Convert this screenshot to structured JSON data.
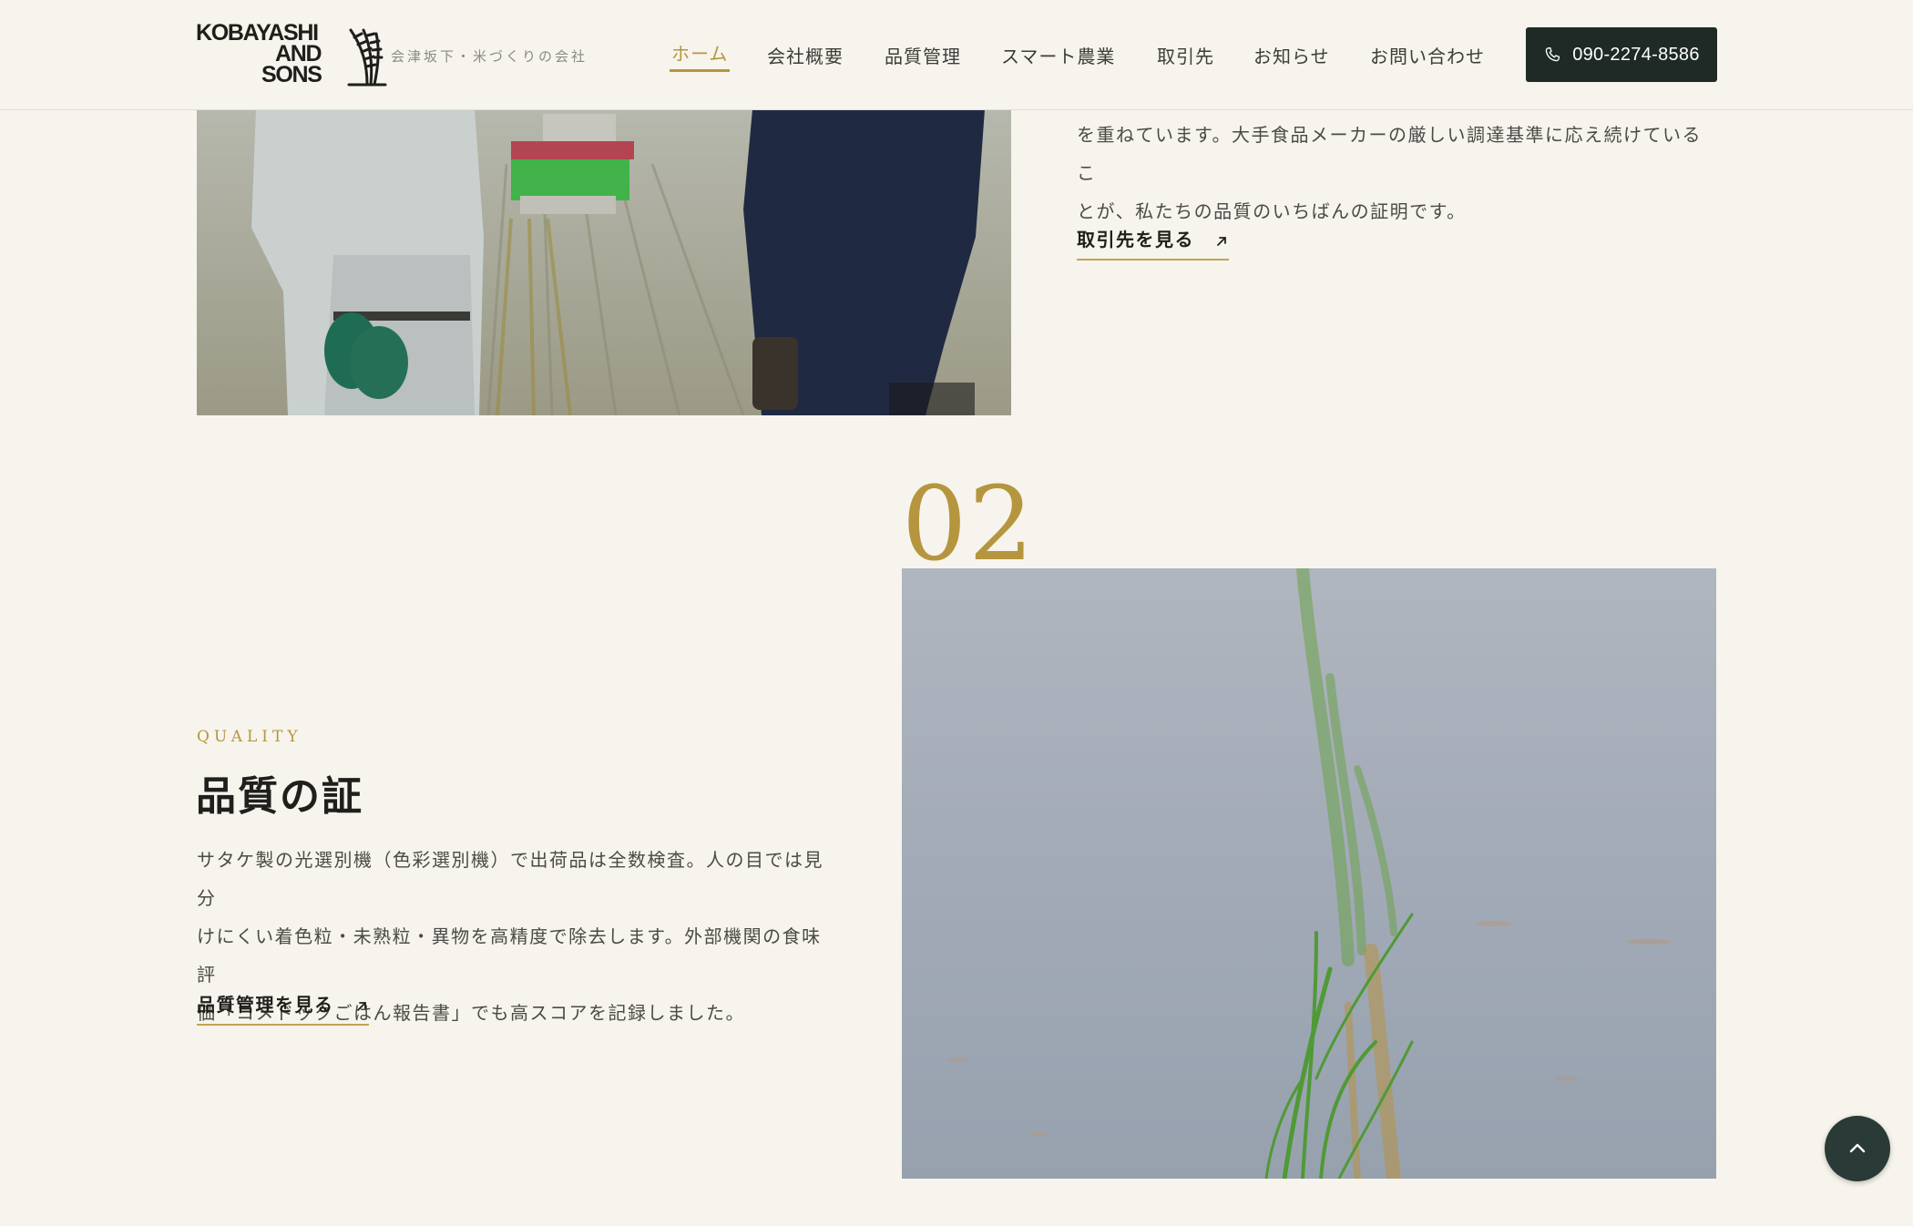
{
  "header": {
    "logo": {
      "line1": "KOBAYASHI",
      "line2": "AND",
      "line3": "SONS"
    },
    "tagline": "会津坂下・米づくりの会社",
    "nav": [
      {
        "label": "ホーム",
        "active": true
      },
      {
        "label": "会社概要"
      },
      {
        "label": "品質管理"
      },
      {
        "label": "スマート農業"
      },
      {
        "label": "取引先"
      },
      {
        "label": "お知らせ"
      },
      {
        "label": "お問い合わせ"
      }
    ],
    "phone": {
      "label": "090-2274-8586",
      "icon": "phone-icon"
    }
  },
  "section01": {
    "photo": "workers-in-rice-field-photo",
    "text_lines": [
      "を重ねています。大手食品メーカーの厳しい調達基準に応え続けているこ",
      "とが、私たちの品質のいちばんの証明です。"
    ],
    "link_label": "取引先を見る"
  },
  "section02": {
    "number": "02",
    "eyebrow": "QUALITY",
    "title": "品質の証",
    "text_lines": [
      "サタケ製の光選別機（色彩選別機）で出荷品は全数検査。人の目では見分",
      "けにくい着色粒・未熟粒・異物を高精度で除去します。外部機関の食味評",
      "価「コメドックごはん報告書」でも高スコアを記録しました。"
    ],
    "link_label": "品質管理を見る",
    "photo": "rice-seedling-in-water-photo"
  },
  "colors": {
    "background": "#f6f4ec",
    "accent_gold": "#b6953f",
    "dark_green": "#1f2a27",
    "text": "#4a4a47"
  },
  "icons": {
    "arrow": "arrow-up-right-icon",
    "to_top": "chevron-up-icon",
    "phone": "phone-icon"
  }
}
